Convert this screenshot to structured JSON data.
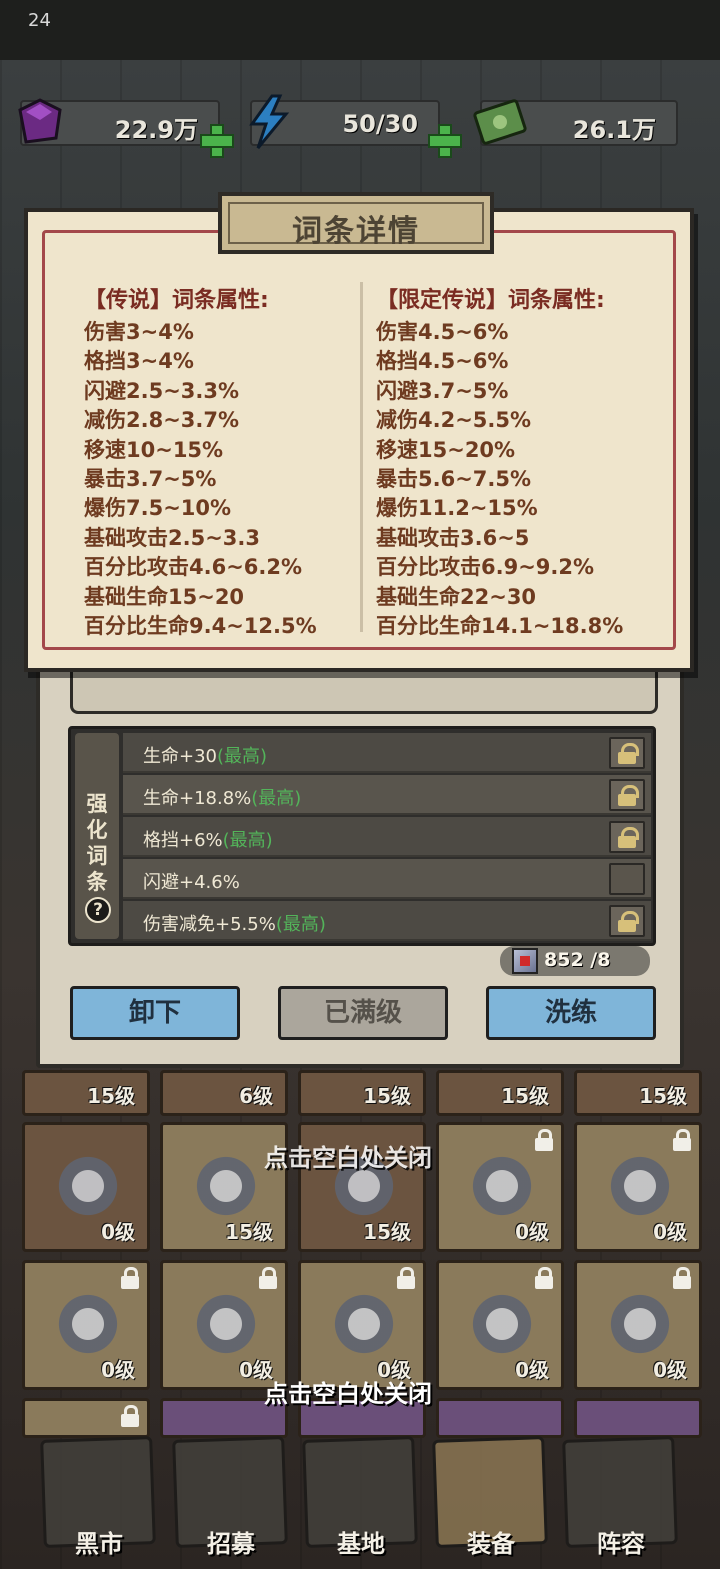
{
  "status_bar": {
    "time": "24"
  },
  "resources": [
    {
      "icon": "purple-gem-icon",
      "value": "22.9万"
    },
    {
      "icon": "energy-bolt-icon",
      "value": "50/30"
    },
    {
      "icon": "cash-icon",
      "value": "26.1万"
    }
  ],
  "popup": {
    "title": "词条详情",
    "legend": {
      "header": "【传说】词条属性:",
      "lines": [
        "伤害3~4%",
        "格挡3~4%",
        "闪避2.5~3.3%",
        "减伤2.8~3.7%",
        "移速10~15%",
        "暴击3.7~5%",
        "爆伤7.5~10%",
        "基础攻击2.5~3.3",
        "百分比攻击4.6~6.2%",
        "基础生命15~20",
        "百分比生命9.4~12.5%"
      ]
    },
    "limited": {
      "header": "【限定传说】词条属性:",
      "lines": [
        "伤害4.5~6%",
        "格挡4.5~6%",
        "闪避3.7~5%",
        "减伤4.2~5.5%",
        "移速15~20%",
        "暴击5.6~7.5%",
        "爆伤11.2~15%",
        "基础攻击3.6~5",
        "百分比攻击6.9~9.2%",
        "基础生命22~30",
        "百分比生命14.1~18.8%"
      ]
    }
  },
  "enhance": {
    "side_label": [
      "强",
      "化",
      "词",
      "条"
    ],
    "help": "?",
    "rows": [
      {
        "text": "生命+30",
        "best": "(最高)",
        "locked": true
      },
      {
        "text": "生命+18.8%",
        "best": "(最高)",
        "locked": true
      },
      {
        "text": "格挡+6%",
        "best": "(最高)",
        "locked": true
      },
      {
        "text": "闪避+4.6%",
        "best": "",
        "locked": false
      },
      {
        "text": "伤害减免+5.5%",
        "best": "(最高)",
        "locked": true
      }
    ],
    "cost": "852 /8"
  },
  "buttons": {
    "unequip": "卸下",
    "maxed": "已满级",
    "reroll": "洗练"
  },
  "grid_row1_levels": [
    "15级",
    "6级",
    "15级",
    "15级",
    "15级"
  ],
  "grid_row2_levels": [
    "0级",
    "15级",
    "15级",
    "0级",
    "0级"
  ],
  "grid_row3_levels": [
    "0级",
    "0级",
    "0级",
    "0级",
    "0级"
  ],
  "close_hint": "点击空白处关闭",
  "nav": [
    "黑市",
    "招募",
    "基地",
    "装备",
    "阵容"
  ],
  "colors": {
    "accent_red": "#a3484a",
    "best_green": "#53b45a",
    "button_blue": "#7fb5d9"
  }
}
